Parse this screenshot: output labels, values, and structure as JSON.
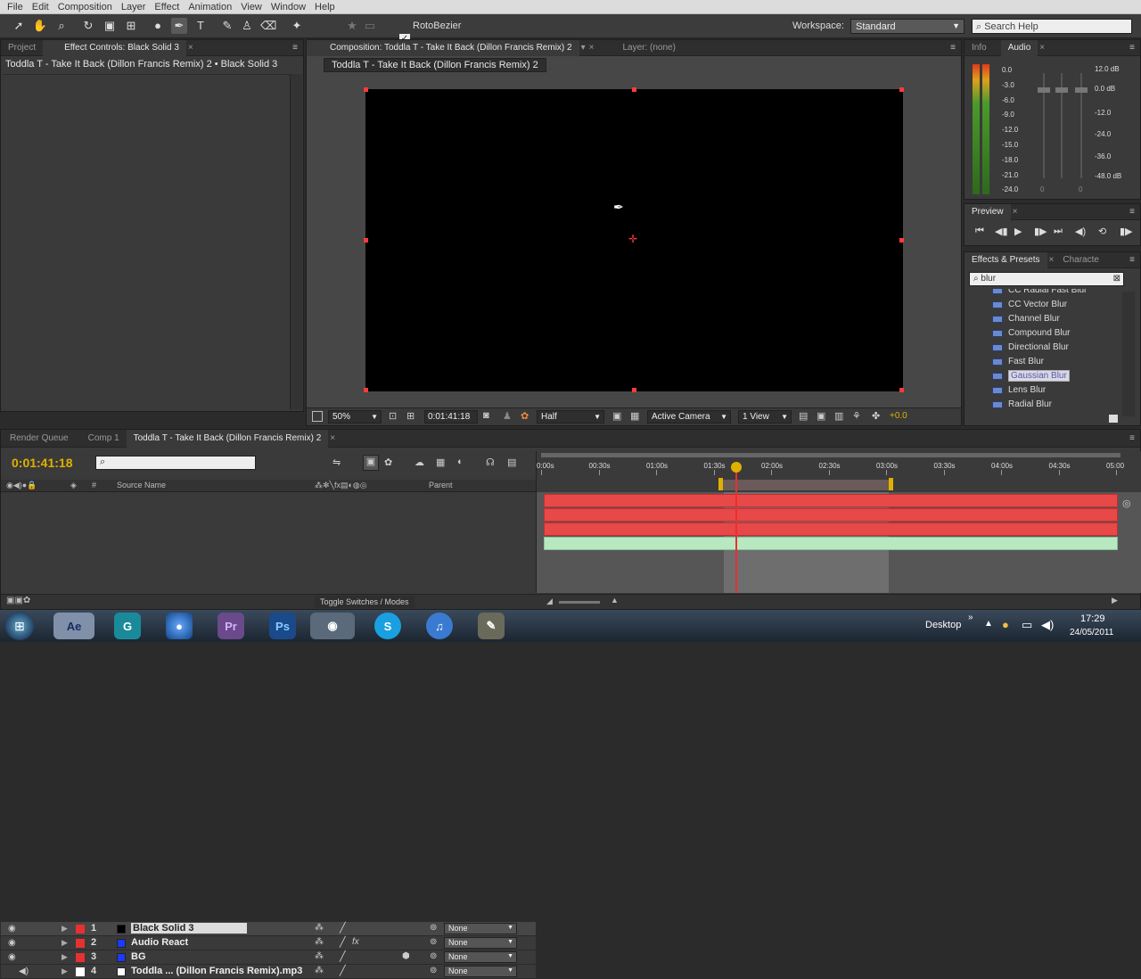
{
  "menu": [
    "File",
    "Edit",
    "Composition",
    "Layer",
    "Effect",
    "Animation",
    "View",
    "Window",
    "Help"
  ],
  "toolbar": {
    "rotobezier_label": "RotoBezier",
    "workspace_label": "Workspace:",
    "workspace_value": "Standard",
    "search_placeholder": "Search Help"
  },
  "left_panel": {
    "tab_project": "Project",
    "tab_effect_controls": "Effect Controls: Black Solid 3",
    "subtitle": "Toddla T - Take It Back (Dillon Francis Remix) 2 • Black Solid 3"
  },
  "viewer": {
    "tab_comp": "Composition: Toddla T - Take It Back (Dillon Francis Remix) 2",
    "tab_layer": "Layer: (none)",
    "comp_button": "Toddla T - Take It Back (Dillon Francis Remix) 2",
    "zoom": "50%",
    "timecode": "0:01:41:18",
    "resolution": "Half",
    "camera": "Active Camera",
    "views": "1 View",
    "exposure": "+0.0"
  },
  "info_panel": {
    "tab_info": "Info",
    "tab_audio": "Audio",
    "left_scale": [
      "0.0",
      "-3.0",
      "-6.0",
      "-9.0",
      "-12.0",
      "-15.0",
      "-18.0",
      "-21.0",
      "-24.0"
    ],
    "right_scale": [
      "12.0 dB",
      "0.0 dB",
      "-12.0",
      "-24.0",
      "-36.0",
      "-48.0 dB"
    ],
    "slider_zero_left": "0",
    "slider_zero_right": "0"
  },
  "preview": {
    "tab": "Preview"
  },
  "effects": {
    "tab_effects": "Effects & Presets",
    "tab_character": "Characte",
    "search_value": "blur",
    "items": [
      "CC Radial Fast Blur",
      "CC Vector Blur",
      "Channel Blur",
      "Compound Blur",
      "Directional Blur",
      "Fast Blur",
      "Gaussian Blur",
      "Lens Blur",
      "Radial Blur"
    ]
  },
  "timeline": {
    "tab_render": "Render Queue",
    "tab_comp1": "Comp 1",
    "tab_active": "Toddla T - Take It Back (Dillon Francis Remix) 2",
    "current_time": "0:01:41:18",
    "col_hash": "#",
    "col_source": "Source Name",
    "col_parent": "Parent",
    "ruler": [
      "0:00s",
      "00:30s",
      "01:00s",
      "01:30s",
      "02:00s",
      "02:30s",
      "03:00s",
      "03:30s",
      "04:00s",
      "04:30s",
      "05:00"
    ],
    "layers": [
      {
        "num": "1",
        "name": "Black Solid 3",
        "color": "#000000",
        "parent": "None"
      },
      {
        "num": "2",
        "name": "Audio React",
        "color": "#1a3aff",
        "parent": "None"
      },
      {
        "num": "3",
        "name": "BG",
        "color": "#1a3aff",
        "parent": "None"
      },
      {
        "num": "4",
        "name": "Toddla ... (Dillon Francis Remix).mp3",
        "color": "#ffffff",
        "parent": "None"
      }
    ],
    "toggle_label": "Toggle Switches / Modes"
  },
  "taskbar": {
    "apps": [
      "Ae",
      "G",
      "",
      "Pr",
      "Ps",
      "",
      "S",
      "",
      ""
    ],
    "desktop_label": "Desktop",
    "clock_time": "17:29",
    "clock_date": "24/05/2011"
  },
  "colors": {
    "layer_bar": "#e84848",
    "audio_bar": "#b8e8c0",
    "timecode": "#e0b000",
    "playhead": "#e83030"
  }
}
